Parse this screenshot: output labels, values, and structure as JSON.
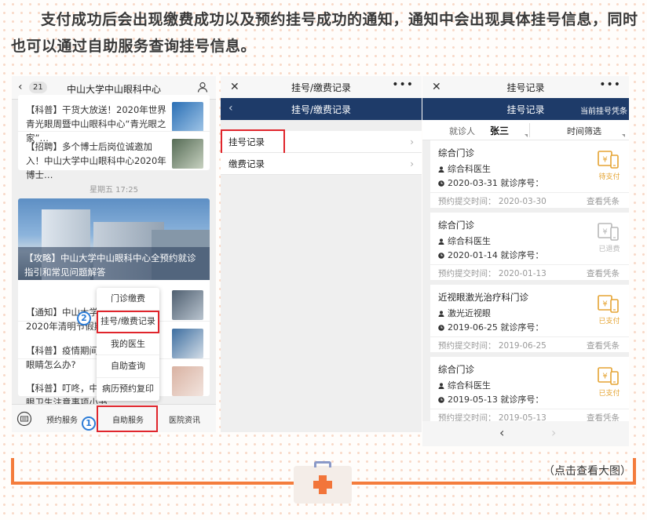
{
  "intro": "支付成功后会出现缴费成功以及预约挂号成功的通知，通知中会出现具体挂号信息，同时也可以通过自助服务查询挂号信息。",
  "panel1": {
    "back": "‹",
    "badge": "21",
    "title": "中山大学中山眼科中心",
    "articles_top": [
      {
        "text": "【科普】干货大放送！2020年世界青光眼周暨中山眼科中心“青光眼之家”…"
      },
      {
        "text": "【招聘】多个博士后岗位诚邀加入！中山大学中山眼科中心2020年博士…"
      }
    ],
    "time": "星期五 17:25",
    "hero_caption": "【攻略】中山大学中山眼科中心全预约就诊指引和常见问题解答",
    "articles_bottom": [
      {
        "text": "【通知】中山大学中\n2020年清明节假期"
      },
      {
        "text": "【科普】疫情期间，\n眼睛怎么办?"
      },
      {
        "text": "【科普】叮咚，中心\n眼卫生注意事项小书"
      }
    ],
    "popup_items": [
      "门诊缴费",
      "挂号/缴费记录",
      "我的医生",
      "自助查询",
      "病历预约复印"
    ],
    "step1": "1",
    "step2": "2",
    "nav": [
      "预约服务",
      "自助服务",
      "医院资讯"
    ]
  },
  "panel2": {
    "close": "✕",
    "title": "挂号/缴费记录",
    "menu": "•••",
    "back": "‹",
    "bar_title": "挂号/缴费记录",
    "items": [
      "挂号记录",
      "缴费记录"
    ],
    "chevron": "›"
  },
  "panel3": {
    "close": "✕",
    "title": "挂号记录",
    "menu": "•••",
    "bar_title": "挂号记录",
    "bar_right": "当前挂号凭条",
    "filter_label": "就诊人",
    "filter_name": "张三",
    "filter_time": "时间筛选",
    "records": [
      {
        "dept": "综合门诊",
        "doctor": "综合科医生",
        "date": "2020-03-31 就诊序号：",
        "submit": "预约提交时间：  2020-03-30",
        "view": "查看凭条",
        "status": "待支付"
      },
      {
        "dept": "综合门诊",
        "doctor": "综合科医生",
        "date": "2020-01-14 就诊序号：",
        "submit": "预约提交时间：  2020-01-13",
        "view": "查看凭条",
        "status": "已退费"
      },
      {
        "dept": "近视眼激光治疗科门诊",
        "doctor": "激光近视眼",
        "date": "2019-06-25 就诊序号：",
        "submit": "预约提交时间：  2019-06-25",
        "view": "查看凭条",
        "status": "已支付"
      },
      {
        "dept": "综合门诊",
        "doctor": "综合科医生",
        "date": "2019-05-13 就诊序号：",
        "submit": "预约提交时间：  2019-05-13",
        "view": "查看凭条",
        "status": "已支付"
      }
    ],
    "prev": "‹",
    "next": "›"
  },
  "footer_hint": "（点击查看大图）",
  "colors": {
    "accent": "#f47c3c",
    "navy": "#1e3b69",
    "highlight": "#e0252c",
    "status_pending": "#e5a433",
    "status_paid": "#e5a433",
    "status_refunded": "#b8b8b8"
  }
}
